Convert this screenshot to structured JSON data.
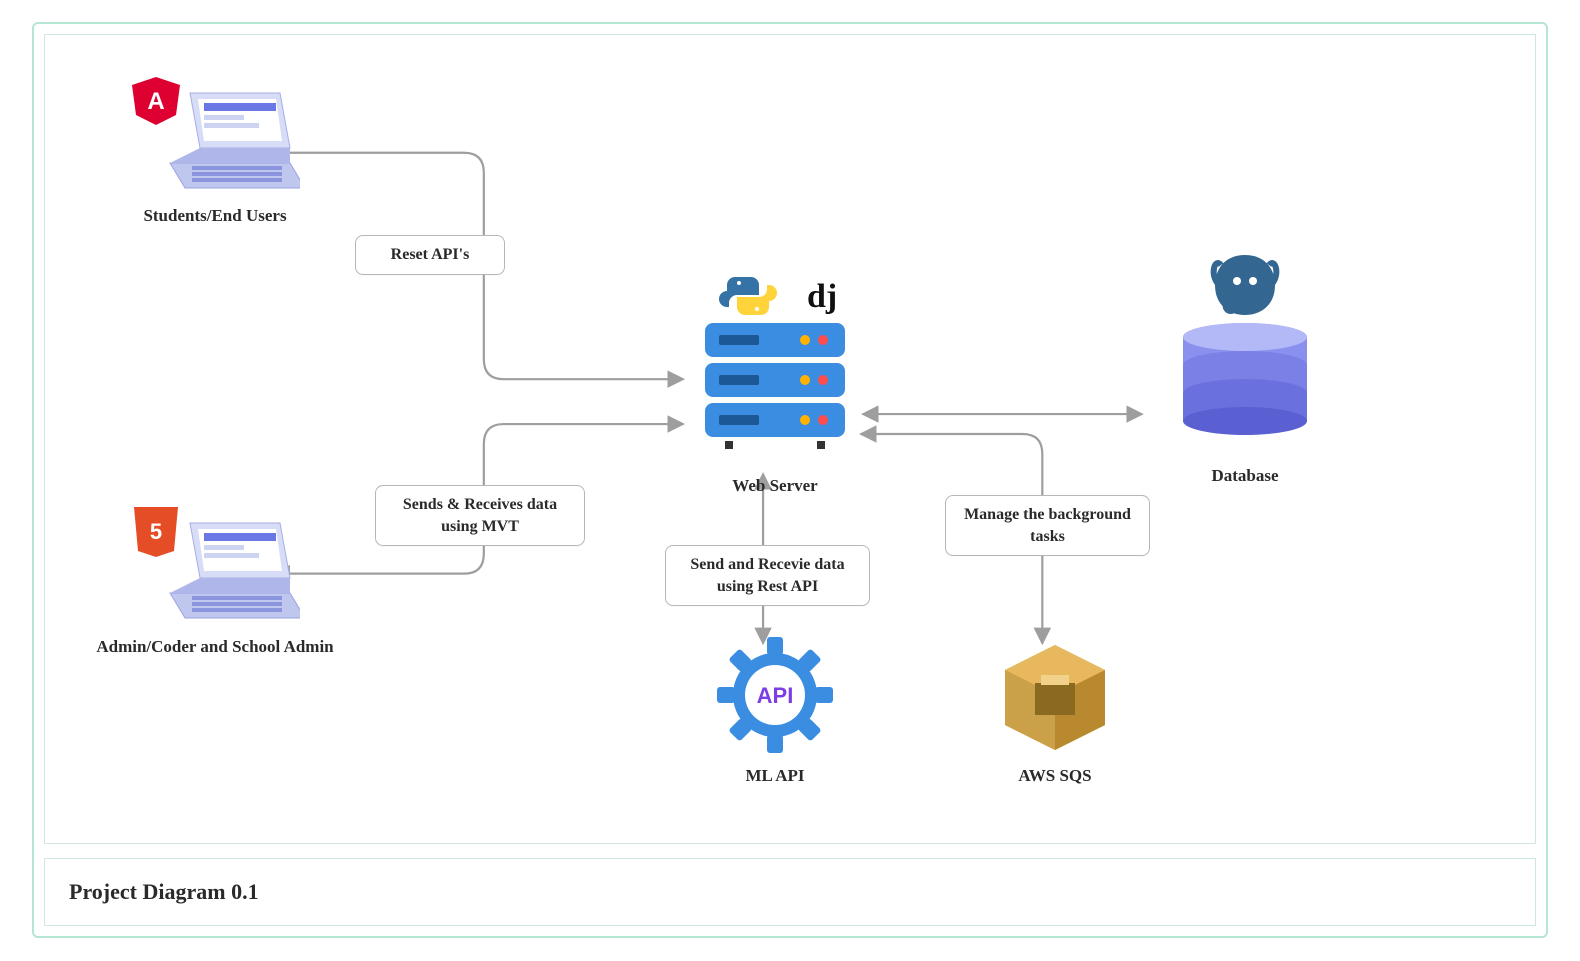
{
  "diagram": {
    "title": "Project Diagram 0.1",
    "nodes": {
      "students": {
        "label": "Students/End Users",
        "tech_icon": "angular"
      },
      "admin": {
        "label": "Admin/Coder and School Admin",
        "tech_icon": "html5"
      },
      "webserver": {
        "label": "Web Server",
        "tech_icons": [
          "python",
          "django"
        ]
      },
      "database": {
        "label": "Database",
        "tech_icon": "postgresql"
      },
      "mlapi": {
        "label": "ML API"
      },
      "awssqs": {
        "label": "AWS SQS"
      }
    },
    "edges": {
      "students_webserver": "Reset API's",
      "admin_webserver": "Sends & Receives data using MVT",
      "webserver_mlapi": "Send and Recevie data using Rest API",
      "webserver_sqs": "Manage the background tasks",
      "webserver_database": ""
    }
  }
}
